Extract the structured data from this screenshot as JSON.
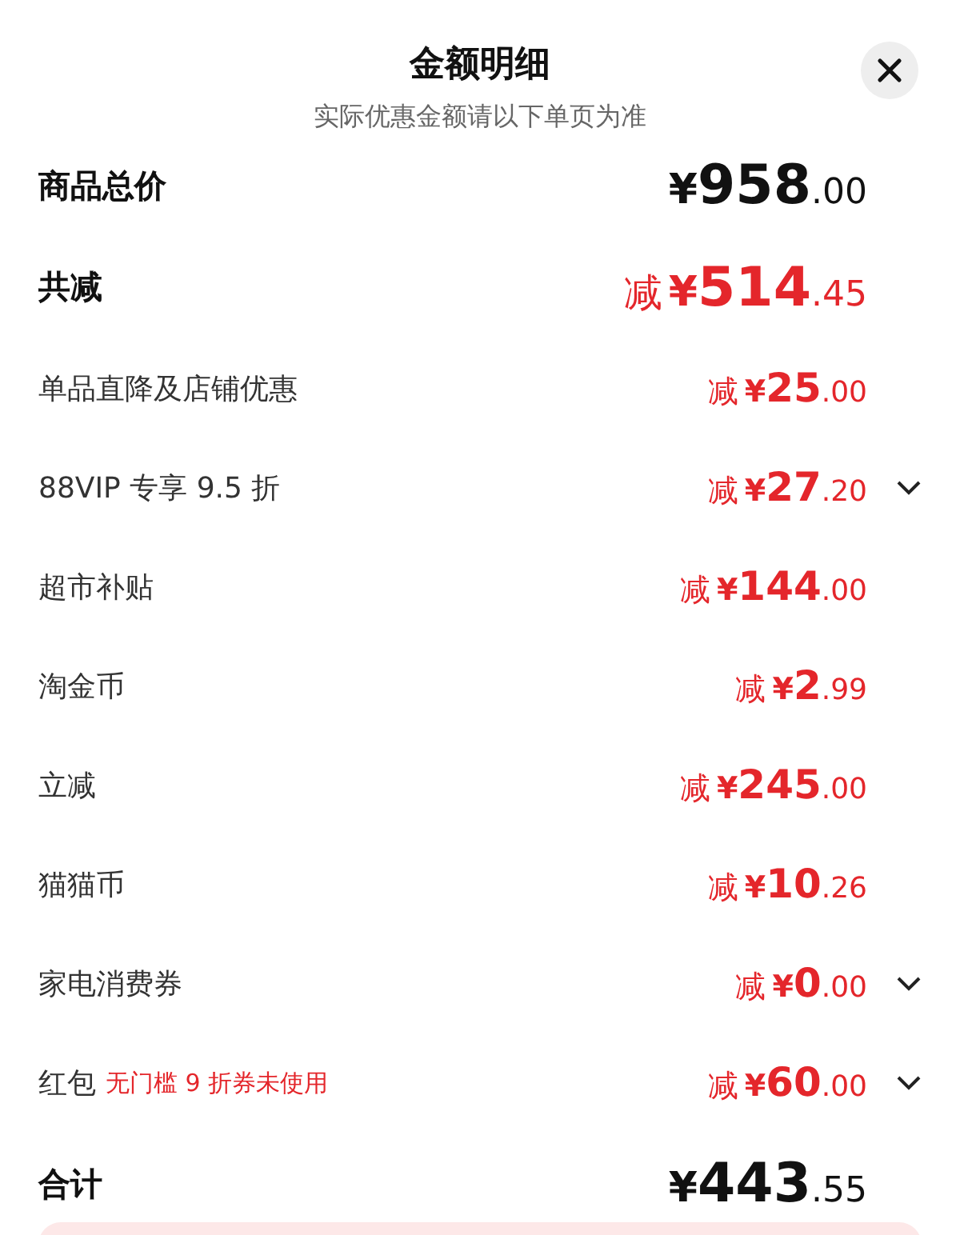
{
  "header": {
    "title": "金额明细",
    "subtitle": "实际优惠金额请以下单页为准"
  },
  "summary": [
    {
      "kind": "total",
      "label": "商品总价",
      "currency": "¥",
      "integer": "958",
      "decimal": ".00"
    },
    {
      "kind": "discount",
      "label": "共减",
      "reduce": "减",
      "currency": "¥",
      "integer": "514",
      "decimal": ".45"
    }
  ],
  "items": [
    {
      "label": "单品直降及店铺优惠",
      "reduce": "减",
      "currency": "¥",
      "integer": "25",
      "decimal": ".00",
      "expandable": false
    },
    {
      "label": "88VIP 专享 9.5 折",
      "reduce": "减",
      "currency": "¥",
      "integer": "27",
      "decimal": ".20",
      "expandable": true
    },
    {
      "label": "超市补贴",
      "reduce": "减",
      "currency": "¥",
      "integer": "144",
      "decimal": ".00",
      "expandable": false
    },
    {
      "label": "淘金币",
      "reduce": "减",
      "currency": "¥",
      "integer": "2",
      "decimal": ".99",
      "expandable": false
    },
    {
      "label": "立减",
      "reduce": "减",
      "currency": "¥",
      "integer": "245",
      "decimal": ".00",
      "expandable": false
    },
    {
      "label": "猫猫币",
      "reduce": "减",
      "currency": "¥",
      "integer": "10",
      "decimal": ".26",
      "expandable": false
    },
    {
      "label": "家电消费券",
      "reduce": "减",
      "currency": "¥",
      "integer": "0",
      "decimal": ".00",
      "expandable": true
    },
    {
      "label": "红包",
      "note": "无门槛 9 折券未使用",
      "reduce": "减",
      "currency": "¥",
      "integer": "60",
      "decimal": ".00",
      "expandable": true
    }
  ],
  "footer": {
    "label": "合计",
    "currency": "¥",
    "integer": "443",
    "decimal": ".55"
  }
}
